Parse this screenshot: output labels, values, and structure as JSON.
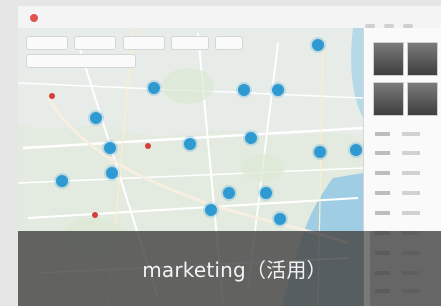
{
  "caption": {
    "text": "marketing（活用）"
  },
  "colors": {
    "cluster": "#2f9ad1",
    "marker": "#d43f3a",
    "overlay": "#464646"
  },
  "icons": [
    "brand-icon",
    "map-cluster-icon",
    "map-marker-icon"
  ]
}
